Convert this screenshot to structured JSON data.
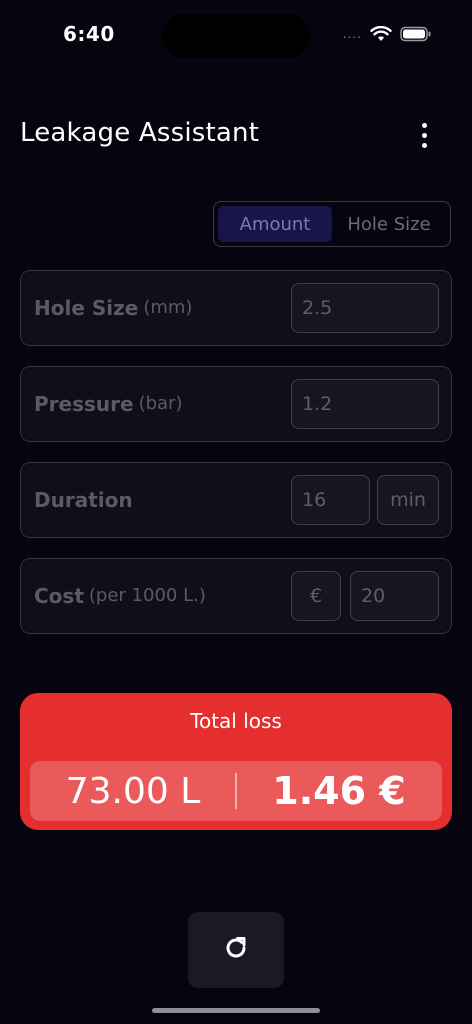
{
  "status_bar": {
    "time": "6:40",
    "dots": "....",
    "wifi_icon": "wifi-icon",
    "battery_icon": "battery-icon"
  },
  "header": {
    "title": "Leakage Assistant",
    "menu_icon": "more-vertical-icon"
  },
  "segmented": {
    "options": [
      {
        "label": "Amount",
        "selected": true
      },
      {
        "label": "Hole Size",
        "selected": false
      }
    ]
  },
  "fields": {
    "hole_size": {
      "label": "Hole Size",
      "unit": "(mm)",
      "value": "2.5"
    },
    "pressure": {
      "label": "Pressure",
      "unit": "(bar)",
      "value": "1.2"
    },
    "duration": {
      "label": "Duration",
      "value": "16",
      "unit_select": "min"
    },
    "cost": {
      "label": "Cost",
      "unit": "(per 1000 L.)",
      "currency": "€",
      "value": "20"
    }
  },
  "total": {
    "title": "Total loss",
    "liters": "73.00 L",
    "euros": "1.46 €"
  },
  "actions": {
    "refresh_icon": "refresh-icon"
  },
  "colors": {
    "background": "#05040f",
    "total_card": "#e52e2e",
    "total_inner": "#ea5a5a",
    "segment_active": "#17154a"
  }
}
